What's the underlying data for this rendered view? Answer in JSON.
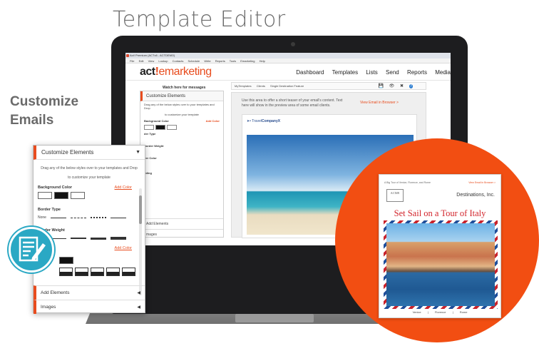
{
  "hero_title": "Template Editor",
  "side_heading": [
    "Customize",
    "Emails"
  ],
  "window": {
    "title": "Act! Premium (ACTv6 - ACTDEMO)",
    "menu": [
      "File",
      "Edit",
      "View",
      "Lookup",
      "Contacts",
      "Schedule",
      "Write",
      "Reports",
      "Tools",
      "Emarketing",
      "Help"
    ]
  },
  "app": {
    "brand_act": "act",
    "brand_bang": "!",
    "brand_product": "emarketing",
    "nav": [
      "Dashboard",
      "Templates",
      "Lists",
      "Send",
      "Reports",
      "Media"
    ]
  },
  "editor": {
    "watch_label": "Watch here for messages",
    "breadcrumb": [
      "MyTemplates",
      "Clients",
      "Single Destination Feature"
    ],
    "tool_icons": [
      "save-icon",
      "preview-icon",
      "close-icon",
      "help-icon"
    ],
    "preview_note": "Use this area to offer a short teaser of your email's content. Text here will show in the preview area of some email clients.",
    "preview_link": "View Email in Browser >",
    "company_logo_prefix": "Travel",
    "company_logo_name": "CompanyX"
  },
  "customize_panel": {
    "header": "Customize Elements",
    "intro_line1": "Drag any of the below styles over to your templates and Drop",
    "intro_line2": "to customize your template",
    "background_color_label": "Background Color",
    "add_color_label": "Add Color",
    "border_type_label": "Border Type",
    "border_weight_label": "Border Weight",
    "border_color_add": "Add Color",
    "none_label": "None",
    "add_elements_label": "Add Elements",
    "images_label": "Images",
    "mini_background_label": "Background Color",
    "mini_border_type": "der Type",
    "mini_border_weight": "Border Weight",
    "mini_border_color": "der Color",
    "mini_padding": "dding",
    "mini_images": "mages",
    "mini_intro_line2": "to customize your template"
  },
  "email_preview": {
    "top_text": "A Big Tour of Venice, Florence, and Rome",
    "browser_link": "View Email in Browser >",
    "logo_text": "ACME",
    "company": "Destinations, Inc.",
    "headline": "Set Sail on a Tour of Italy",
    "cities": [
      "Venice",
      "|",
      "Florence",
      "|",
      "Rome"
    ]
  },
  "colors": {
    "accent_orange": "#f24e12",
    "brand_orange": "#e84c1e",
    "teal_icon": "#2aa8c4",
    "headline_red": "#d2232a"
  }
}
